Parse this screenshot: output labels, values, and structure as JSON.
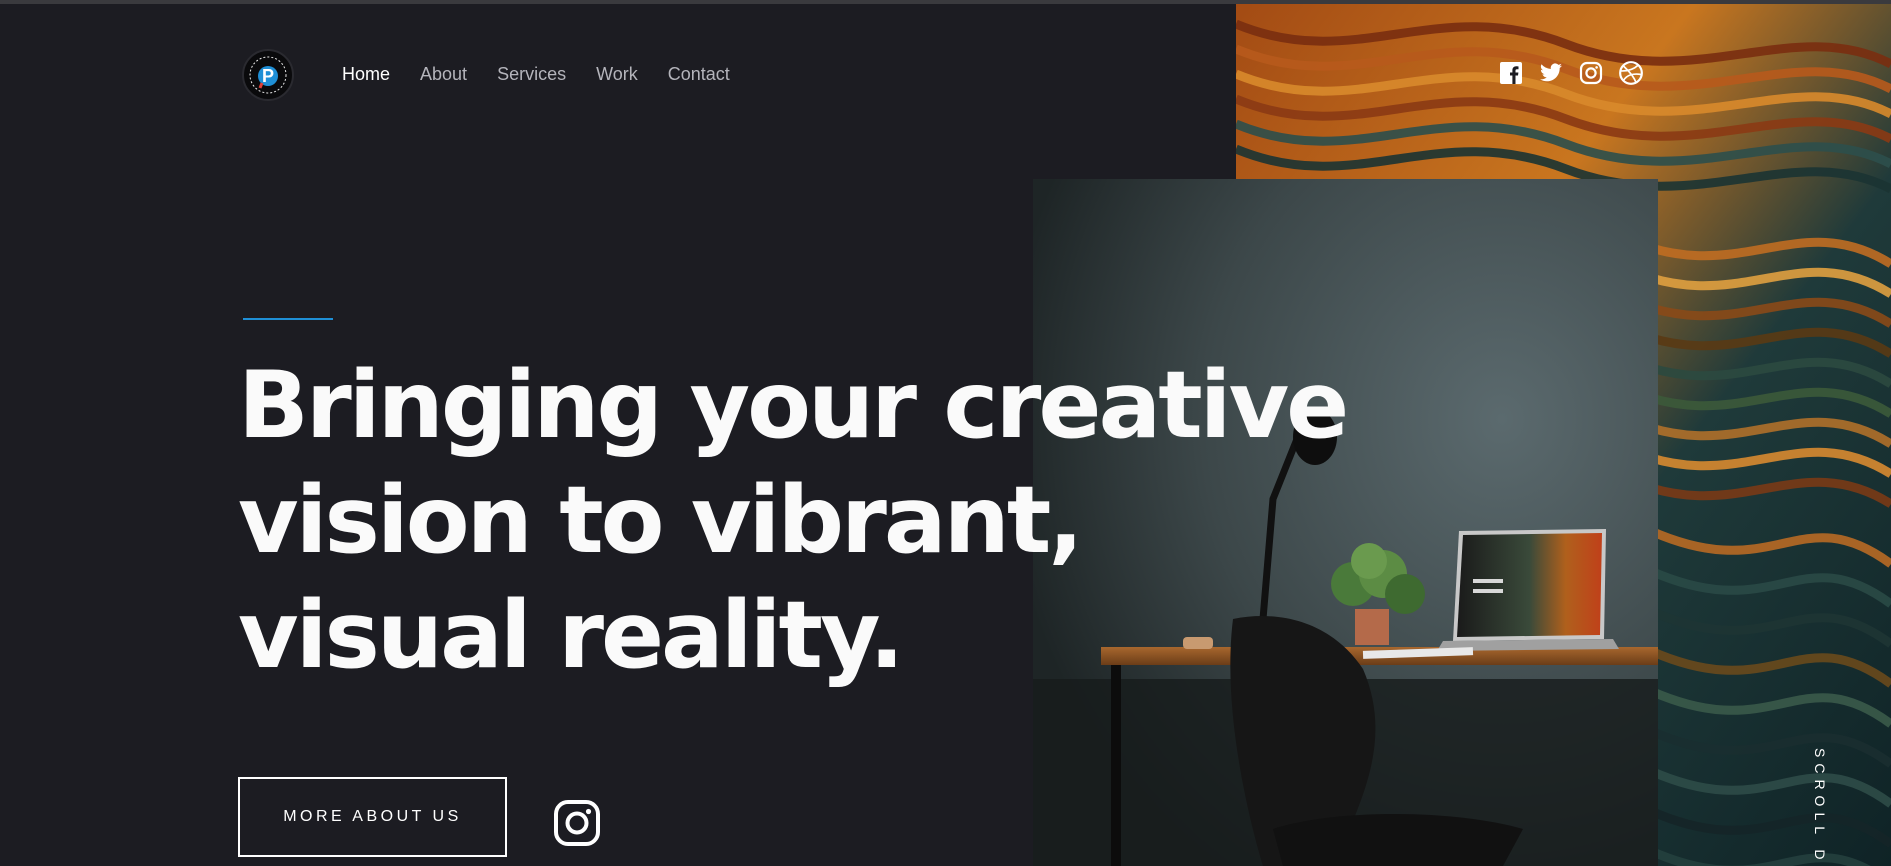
{
  "nav": {
    "items": [
      {
        "label": "Home",
        "active": true
      },
      {
        "label": "About",
        "active": false
      },
      {
        "label": "Services",
        "active": false
      },
      {
        "label": "Work",
        "active": false
      },
      {
        "label": "Contact",
        "active": false
      }
    ]
  },
  "logo": {
    "letter": "P"
  },
  "social": [
    "facebook-icon",
    "twitter-icon",
    "instagram-icon",
    "dribbble-icon"
  ],
  "hero": {
    "line1": "Bringing your creative",
    "line2": "vision to vibrant,",
    "line3": "visual reality.",
    "cta_label": "MORE ABOUT US"
  },
  "scroll_label": "SCROLL DO",
  "colors": {
    "background": "#1c1c22",
    "accent": "#1f8fd6",
    "text": "#ffffff",
    "nav_inactive": "#b4b4bb"
  }
}
